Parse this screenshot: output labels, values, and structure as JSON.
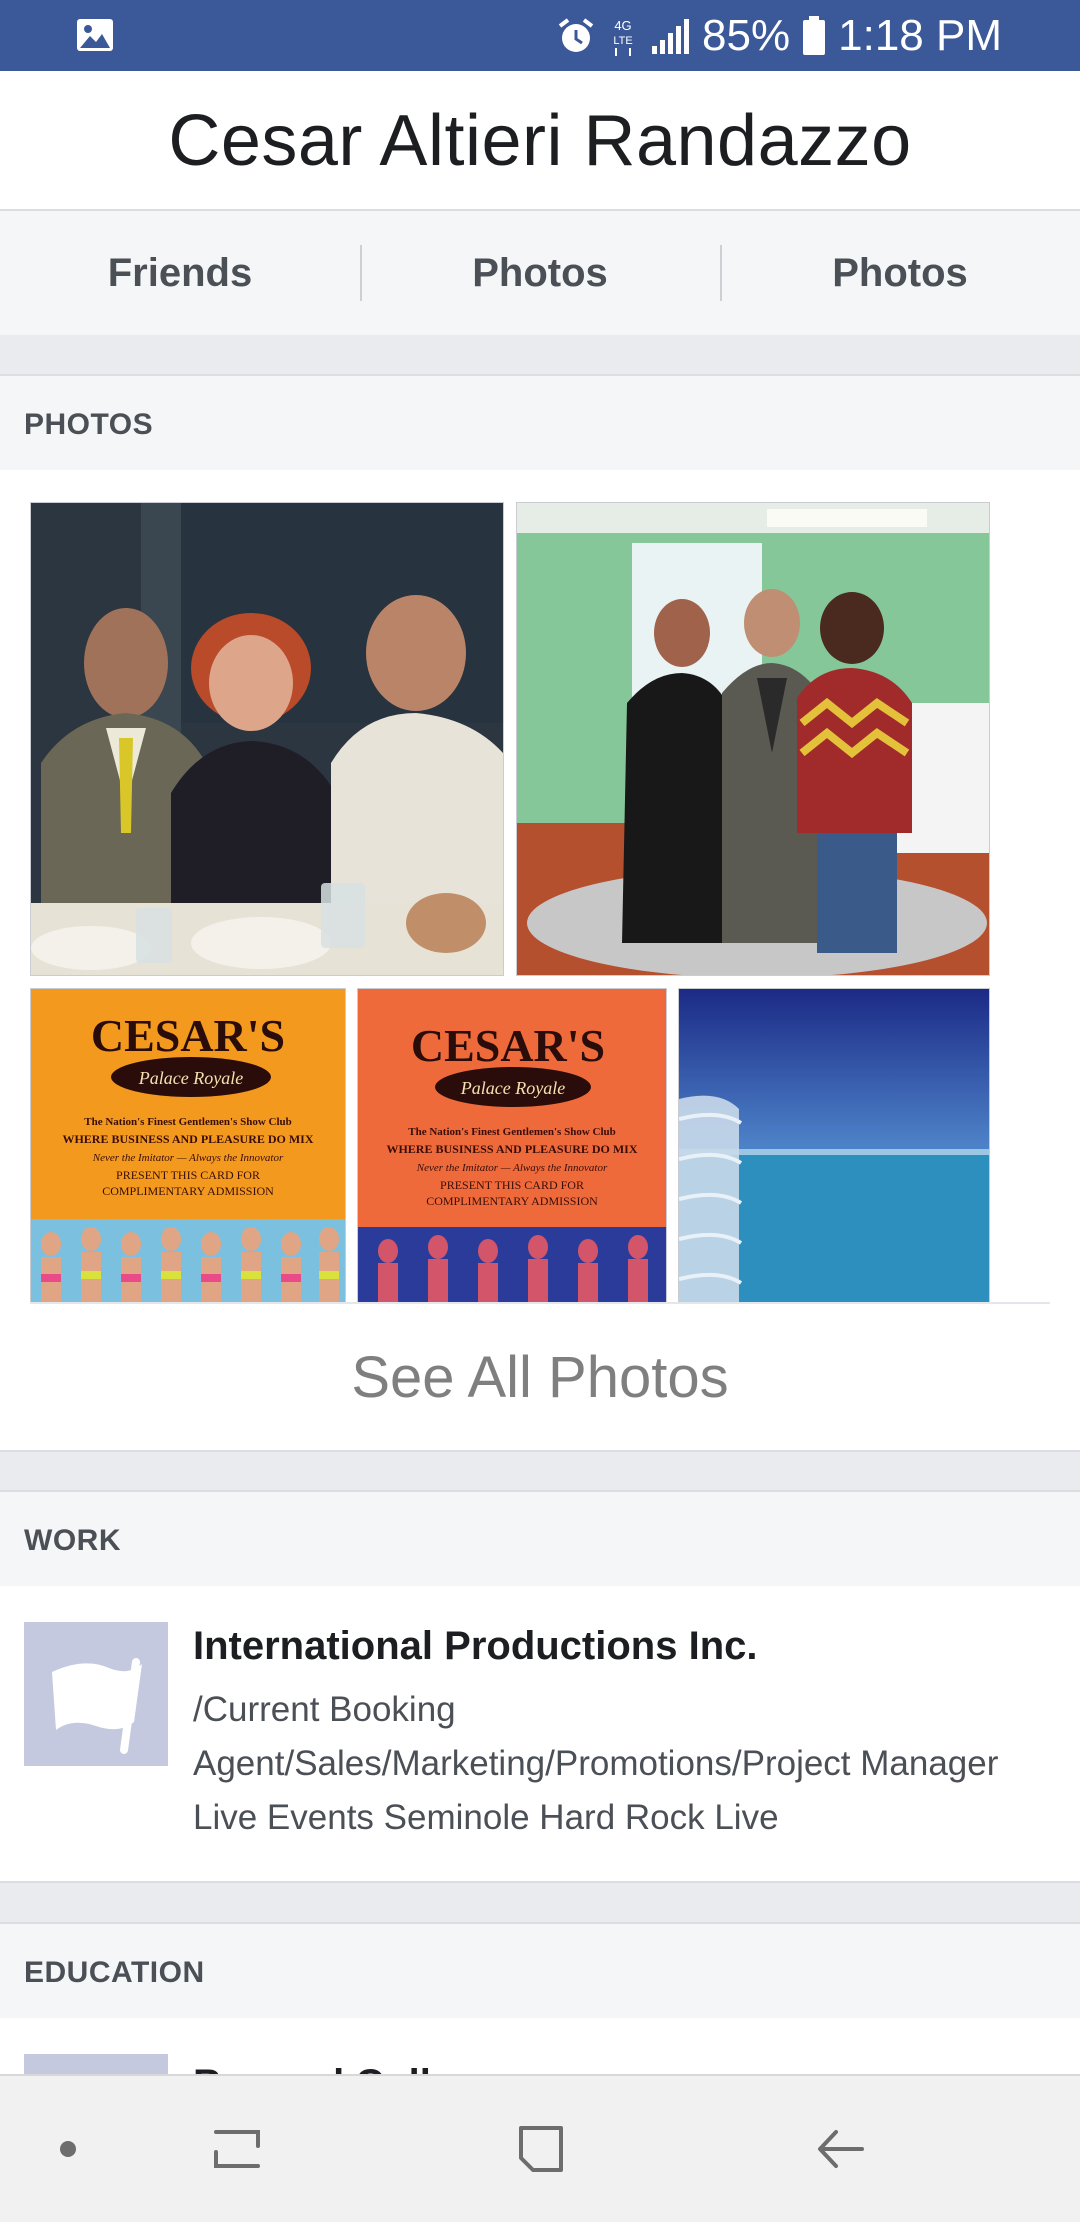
{
  "status_bar": {
    "battery": "85%",
    "time": "1:18 PM",
    "network": "4G LTE"
  },
  "profile": {
    "name": "Cesar Altieri Randazzo"
  },
  "tabs": [
    {
      "label": "Friends"
    },
    {
      "label": "Photos"
    },
    {
      "label": "Photos"
    }
  ],
  "photos": {
    "heading": "PHOTOS",
    "see_all": "See All Photos",
    "card_text": {
      "brand": "CESAR'S",
      "sub": "Palace Royale",
      "line1": "The Nation's Finest Gentlemen's Show Club",
      "line2": "WHERE BUSINESS AND PLEASURE DO MIX",
      "line3": "Never the Imitator — Always the Innovator",
      "line4": "PRESENT THIS CARD FOR",
      "line5": "COMPLIMENTARY ADMISSION"
    }
  },
  "work": {
    "heading": "WORK",
    "title": "International Productions Inc.",
    "lines": [
      "/Current Booking",
      "Agent/Sales/Marketing/Promotions/Project Manager",
      "Live Events Seminole Hard Rock Live"
    ]
  },
  "education": {
    "heading": "EDUCATION",
    "name": "Brevard College"
  },
  "colors": {
    "status_bar": "#3b5998",
    "section_bg": "#f5f6f7",
    "gap": "#e9ebee",
    "logo_bg": "#c4c9df"
  }
}
